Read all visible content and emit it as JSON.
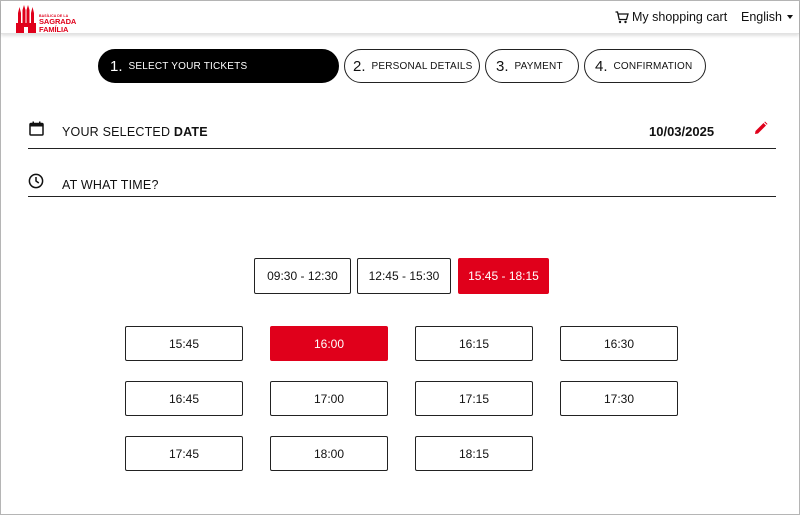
{
  "brand": {
    "logo_line1": "BASÍLICA DE LA",
    "logo_line2": "SAGRADA",
    "logo_line3": "FAMÍLIA",
    "color": "#e0001b"
  },
  "header": {
    "cart_label": "My shopping cart",
    "cart_icon": "shopping-cart-icon",
    "language_label": "English"
  },
  "steps": [
    {
      "number": "1.",
      "label": "SELECT YOUR TICKETS",
      "active": true
    },
    {
      "number": "2.",
      "label": "PERSONAL DETAILS",
      "active": false
    },
    {
      "number": "3.",
      "label": "PAYMENT",
      "active": false
    },
    {
      "number": "4.",
      "label": "CONFIRMATION",
      "active": false
    }
  ],
  "date_row": {
    "icon": "calendar-icon",
    "label_prefix": "YOUR SELECTED ",
    "label_bold": "DATE",
    "value": "10/03/2025",
    "edit_icon": "pencil-icon"
  },
  "time_row": {
    "icon": "clock-icon",
    "label": "AT WHAT TIME?"
  },
  "time_ranges": [
    {
      "label": "09:30 - 12:30",
      "selected": false
    },
    {
      "label": "12:45 - 15:30",
      "selected": false
    },
    {
      "label": "15:45 - 18:15",
      "selected": true
    }
  ],
  "time_slots": [
    {
      "label": "15:45",
      "selected": false
    },
    {
      "label": "16:00",
      "selected": true
    },
    {
      "label": "16:15",
      "selected": false
    },
    {
      "label": "16:30",
      "selected": false
    },
    {
      "label": "16:45",
      "selected": false
    },
    {
      "label": "17:00",
      "selected": false
    },
    {
      "label": "17:15",
      "selected": false
    },
    {
      "label": "17:30",
      "selected": false
    },
    {
      "label": "17:45",
      "selected": false
    },
    {
      "label": "18:00",
      "selected": false
    },
    {
      "label": "18:15",
      "selected": false
    }
  ],
  "colors": {
    "accent": "#e0001b",
    "active_step": "#000000"
  }
}
